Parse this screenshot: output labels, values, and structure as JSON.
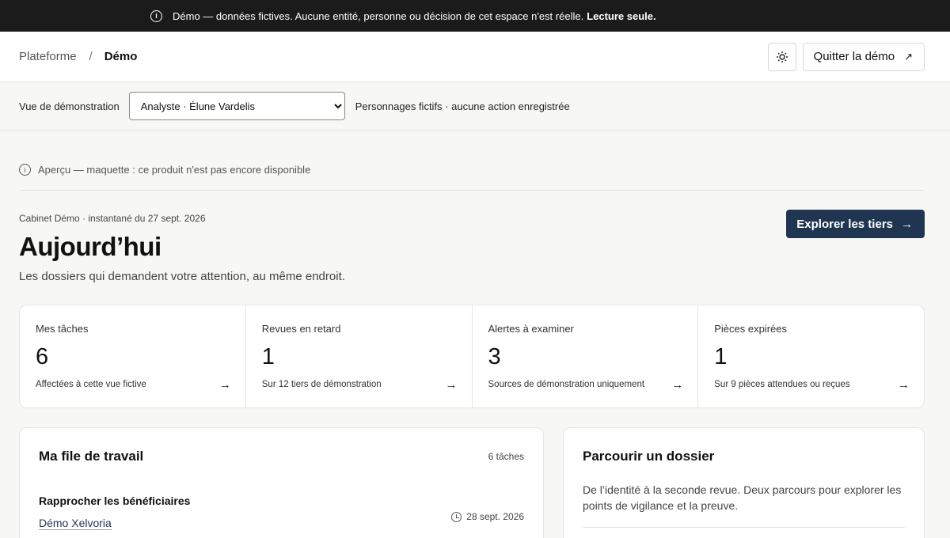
{
  "banner": {
    "icon": "info-icon",
    "text": "Démo — données fictives. Aucune entité, personne ou décision de cet espace n'est réelle.",
    "bold": "Lecture seule."
  },
  "topbar": {
    "breadcrumb_root": "Plateforme",
    "breadcrumb_sep": "/",
    "breadcrumb_current": "Démo",
    "theme_icon": "sun-icon",
    "quit_label": "Quitter la démo",
    "quit_icon": "external-arrow-icon"
  },
  "viewbar": {
    "label": "Vue de démonstration",
    "selected": "Analyste · Élune Vardelis",
    "note": "Personnages fictifs · aucune action enregistrée"
  },
  "preview": {
    "icon": "info-icon",
    "text": "Aperçu — maquette : ce produit n'est pas encore disponible"
  },
  "header": {
    "snapshot": "Cabinet Démo · instantané du 27 sept. 2026",
    "title": "Aujourd’hui",
    "subtitle": "Les dossiers qui demandent votre attention, au même endroit.",
    "explore_label": "Explorer les tiers"
  },
  "stats": [
    {
      "label": "Mes tâches",
      "value": "6",
      "note": "Affectées à cette vue fictive"
    },
    {
      "label": "Revues en retard",
      "value": "1",
      "note": "Sur 12 tiers de démonstration"
    },
    {
      "label": "Alertes à examiner",
      "value": "3",
      "note": "Sources de démonstration uniquement"
    },
    {
      "label": "Pièces expirées",
      "value": "1",
      "note": "Sur 9 pièces attendues ou reçues"
    }
  ],
  "worklist": {
    "title": "Ma file de travail",
    "count": "6 tâches",
    "tasks": [
      {
        "title": "Rapprocher les bénéficiaires",
        "link": "Démo Xelvoria",
        "date": "28 sept. 2026"
      }
    ]
  },
  "browse": {
    "title": "Parcourir un dossier",
    "text": "De l’identité à la seconde revue. Deux parcours pour explorer les points de vigilance et la preuve."
  },
  "colors": {
    "banner_bg": "#1b1b1b",
    "primary": "#1f3552",
    "page_bg": "#f7f7f5"
  }
}
